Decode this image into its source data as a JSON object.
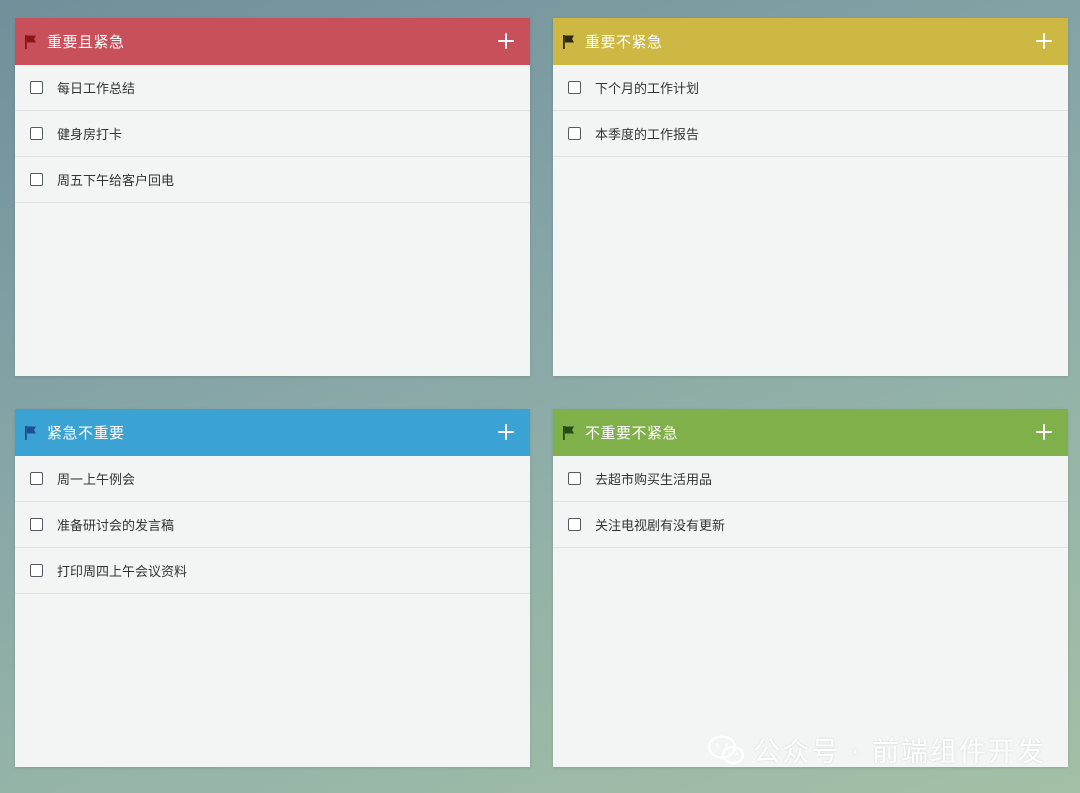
{
  "colors": {
    "q1": "#c8505a",
    "q2": "#cdb843",
    "q3": "#3ba3d4",
    "q4": "#7fb049"
  },
  "quadrants": [
    {
      "title": "重要且紧急",
      "flag_color": "#8b1616",
      "icon": "flag-icon",
      "add_icon": "plus-icon",
      "tasks": [
        "每日工作总结",
        "健身房打卡",
        "周五下午给客户回电"
      ]
    },
    {
      "title": "重要不紧急",
      "flag_color": "#2e2a12",
      "icon": "flag-icon",
      "add_icon": "plus-icon",
      "tasks": [
        "下个月的工作计划",
        "本季度的工作报告"
      ]
    },
    {
      "title": "紧急不重要",
      "flag_color": "#1e4f8e",
      "icon": "flag-icon",
      "add_icon": "plus-icon",
      "tasks": [
        "周一上午例会",
        "准备研讨会的发言稿",
        "打印周四上午会议资料"
      ]
    },
    {
      "title": "不重要不紧急",
      "flag_color": "#1f4d16",
      "icon": "flag-icon",
      "add_icon": "plus-icon",
      "tasks": [
        "去超市购买生活用品",
        "关注电视剧有没有更新"
      ]
    }
  ],
  "watermark": {
    "icon": "wechat-icon",
    "text": "公众号 · 前端组件开发"
  }
}
